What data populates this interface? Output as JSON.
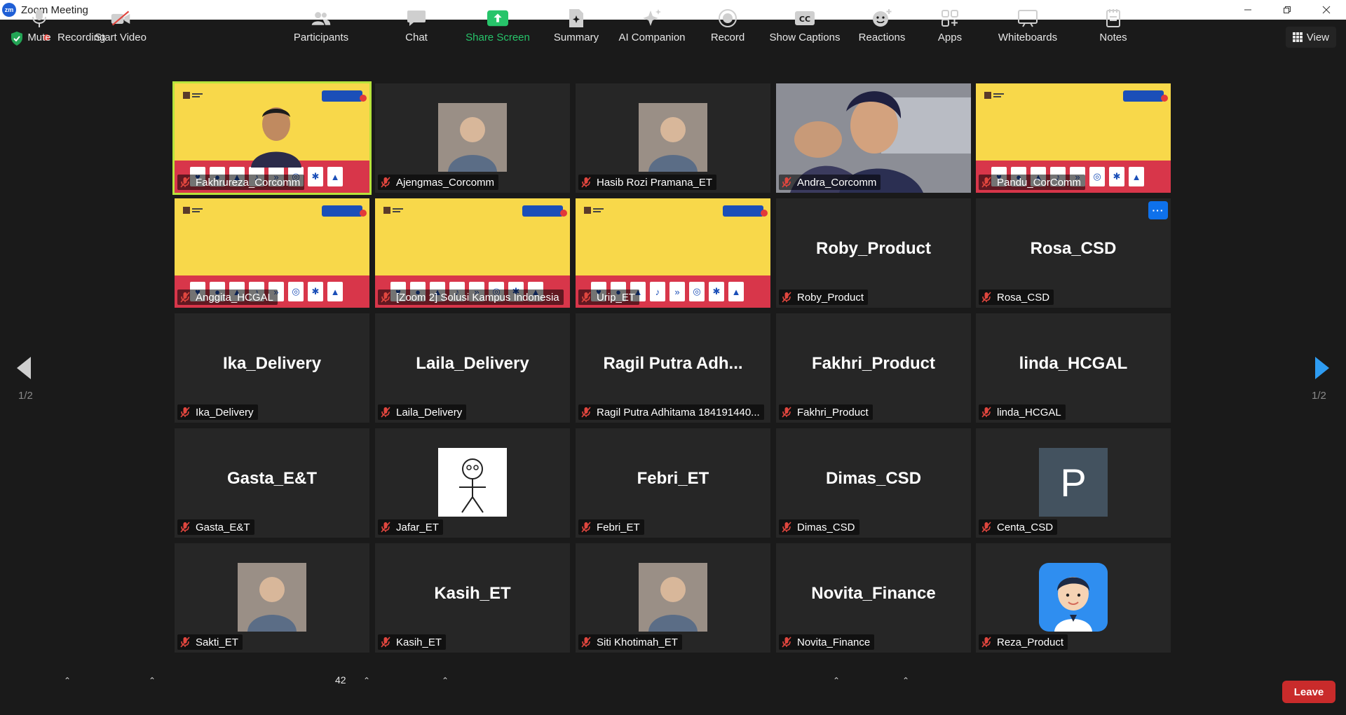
{
  "window": {
    "title": "Zoom Meeting",
    "logo_text": "zm"
  },
  "status": {
    "recording_label": "Recording",
    "view_label": "View"
  },
  "pagination": {
    "left": "1/2",
    "right": "1/2"
  },
  "tiles": [
    {
      "name": "Fakhrureza_Corcomm",
      "kind": "banner-person",
      "active": true
    },
    {
      "name": "Ajengmas_Corcomm",
      "kind": "photo"
    },
    {
      "name": "Hasib Rozi Pramana_ET",
      "kind": "photo"
    },
    {
      "name": "Andra_Corcomm",
      "kind": "camera"
    },
    {
      "name": "Pandu_CorComm",
      "kind": "banner"
    },
    {
      "name": "Anggita_HCGAL",
      "kind": "banner"
    },
    {
      "name": "[Zoom 2] Solusi Kampus Indonesia",
      "kind": "banner"
    },
    {
      "name": "Urip_ET",
      "kind": "banner"
    },
    {
      "name": "Roby_Product",
      "big": "Roby_Product",
      "kind": "text"
    },
    {
      "name": "Rosa_CSD",
      "big": "Rosa_CSD",
      "kind": "text",
      "more": "···"
    },
    {
      "name": "Ika_Delivery",
      "big": "Ika_Delivery",
      "kind": "text"
    },
    {
      "name": "Laila_Delivery",
      "big": "Laila_Delivery",
      "kind": "text"
    },
    {
      "name": "Ragil Putra Adhitama 184191440...",
      "big": "Ragil Putra Adh...",
      "kind": "text"
    },
    {
      "name": "Fakhri_Product",
      "big": "Fakhri_Product",
      "kind": "text"
    },
    {
      "name": "linda_HCGAL",
      "big": "linda_HCGAL",
      "kind": "text"
    },
    {
      "name": "Gasta_E&T",
      "big": "Gasta_E&T",
      "kind": "text"
    },
    {
      "name": "Jafar_ET",
      "kind": "stickman"
    },
    {
      "name": "Febri_ET",
      "big": "Febri_ET",
      "kind": "text"
    },
    {
      "name": "Dimas_CSD",
      "big": "Dimas_CSD",
      "kind": "text"
    },
    {
      "name": "Centa_CSD",
      "kind": "letter",
      "letter": "P"
    },
    {
      "name": "Sakti_ET",
      "kind": "photo"
    },
    {
      "name": "Kasih_ET",
      "big": "Kasih_ET",
      "kind": "text"
    },
    {
      "name": "Siti Khotimah_ET",
      "kind": "photo"
    },
    {
      "name": "Novita_Finance",
      "big": "Novita_Finance",
      "kind": "text"
    },
    {
      "name": "Reza_Product",
      "kind": "cartoon"
    }
  ],
  "toolbar": {
    "mute": "Mute",
    "start_video": "Start Video",
    "participants": "Participants",
    "participants_count": "42",
    "chat": "Chat",
    "share_screen": "Share Screen",
    "summary": "Summary",
    "ai_companion": "AI Companion",
    "record": "Record",
    "show_captions": "Show Captions",
    "reactions": "Reactions",
    "apps": "Apps",
    "whiteboards": "Whiteboards",
    "notes": "Notes",
    "leave": "Leave"
  },
  "colors": {
    "accent_blue": "#0e71eb",
    "share_green": "#27c46a",
    "leave_red": "#c92b2b",
    "active_speaker": "#b7e33b"
  }
}
